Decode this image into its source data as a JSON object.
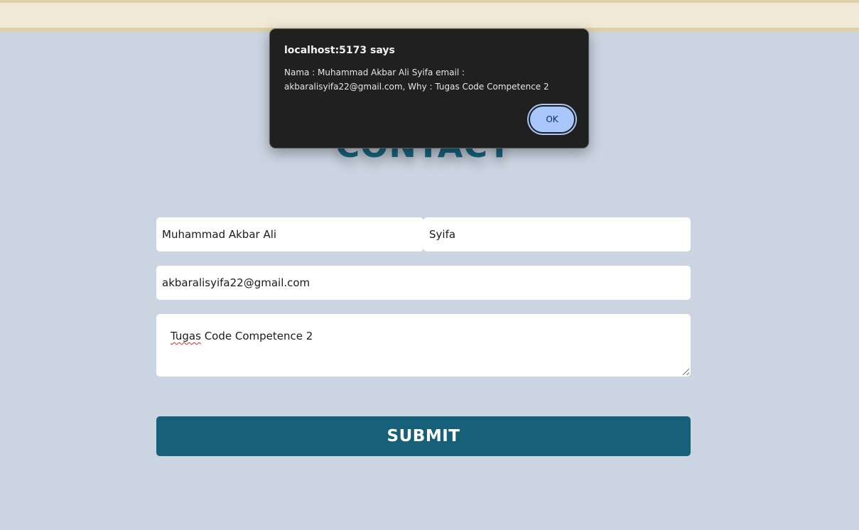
{
  "page": {
    "title": "CONTACT"
  },
  "form": {
    "first_name_value": "Muhammad Akbar Ali",
    "last_name_value": "Syifa",
    "email_value": "akbaralisyifa22@gmail.com",
    "message_first_word": "Tugas",
    "message_rest": " Code Competence 2",
    "submit_label": "SUBMIT"
  },
  "alert": {
    "title": "localhost:5173 says",
    "message": "Nama : Muhammad Akbar Ali Syifa email : akbaralisyifa22@gmail.com, Why : Tugas Code Competence 2",
    "ok_label": "OK"
  },
  "colors": {
    "background": "#cbd5e1",
    "accent": "#17607a",
    "dialog": "#202020",
    "ok_button": "#a9c7fb"
  }
}
